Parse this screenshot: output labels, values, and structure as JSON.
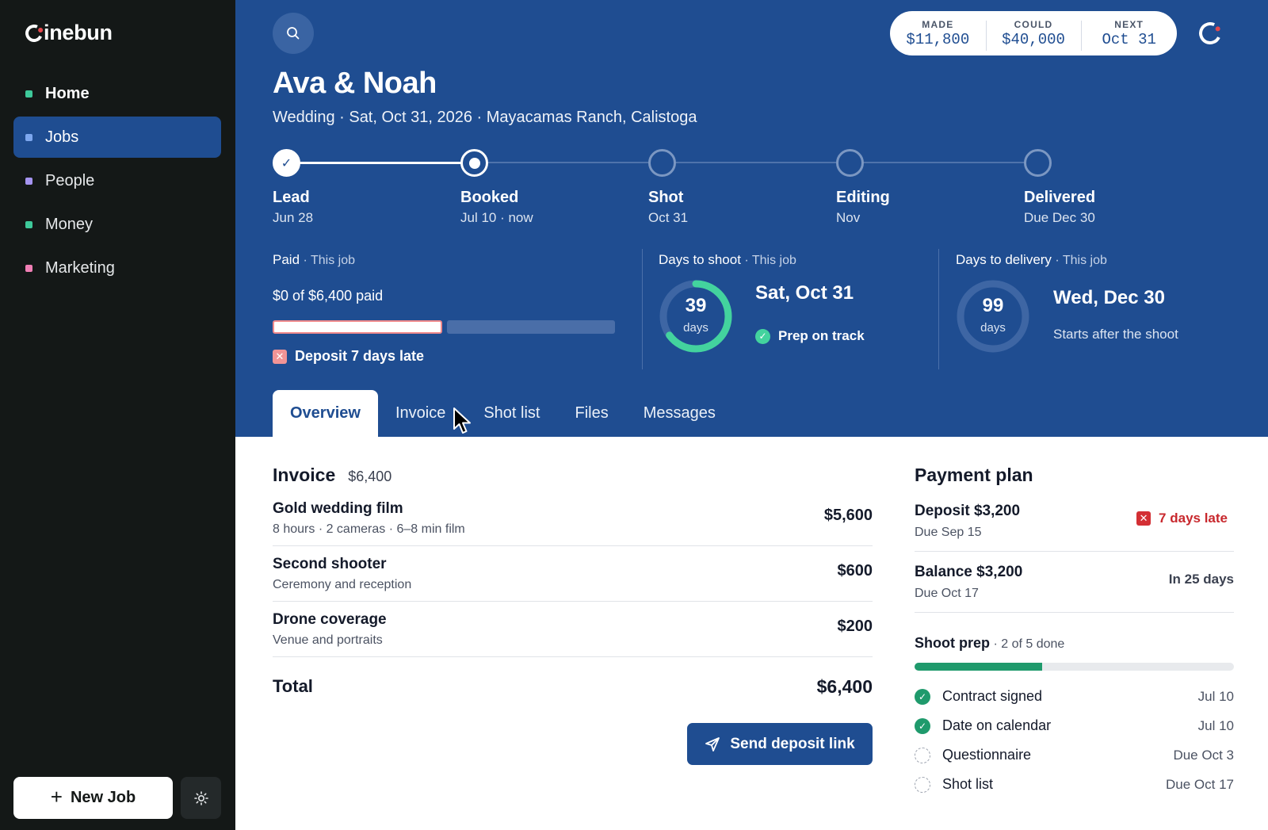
{
  "app": {
    "logo_rest": "inebun"
  },
  "sidebar": {
    "items": [
      {
        "label": "Home",
        "color": "#3ec99a"
      },
      {
        "label": "Jobs",
        "color": "#7da7ee"
      },
      {
        "label": "People",
        "color": "#a594f0"
      },
      {
        "label": "Money",
        "color": "#3ec99a"
      },
      {
        "label": "Marketing",
        "color": "#f07fb5"
      }
    ],
    "new_job_label": "New Job"
  },
  "stats": {
    "made_label": "MADE",
    "made_value": "$11,800",
    "could_label": "COULD",
    "could_value": "$40,000",
    "next_label": "NEXT",
    "next_value": "Oct 31"
  },
  "job": {
    "title": "Ava & Noah",
    "subtitle": "Wedding · Sat, Oct 31, 2026 · Mayacamas Ranch, Calistoga"
  },
  "stepper": {
    "steps": [
      {
        "label": "Lead",
        "date": "Jun 28"
      },
      {
        "label": "Booked",
        "date": "Jul 10 · now"
      },
      {
        "label": "Shot",
        "date": "Oct 31"
      },
      {
        "label": "Editing",
        "date": "Nov"
      },
      {
        "label": "Delivered",
        "date": "Due Dec 30"
      }
    ]
  },
  "metrics": {
    "paid": {
      "title": "Paid",
      "scope": " · This job",
      "amount": "$0 of $6,400 paid",
      "late_note": "Deposit 7 days late"
    },
    "shoot": {
      "title": "Days to shoot",
      "scope": " · This job",
      "days": "39",
      "unit": "days",
      "ring_fraction": 0.65,
      "date": "Sat, Oct 31",
      "status": "Prep on track"
    },
    "delivery": {
      "title": "Days to delivery",
      "scope": " · This job",
      "days": "99",
      "unit": "days",
      "date": "Wed, Dec 30",
      "note": "Starts after the shoot"
    }
  },
  "tabs": [
    "Overview",
    "Invoice",
    "Shot list",
    "Files",
    "Messages"
  ],
  "invoice": {
    "title": "Invoice",
    "amount": "$6,400",
    "items": [
      {
        "name": "Gold wedding film",
        "desc": "8 hours · 2 cameras · 6–8 min film",
        "price": "$5,600"
      },
      {
        "name": "Second shooter",
        "desc": "Ceremony and reception",
        "price": "$600"
      },
      {
        "name": "Drone coverage",
        "desc": "Venue and portraits",
        "price": "$200"
      }
    ],
    "total_label": "Total",
    "total_value": "$6,400",
    "send_label": "Send deposit link"
  },
  "plan": {
    "title": "Payment plan",
    "rows": [
      {
        "name": "Deposit $3,200",
        "due": "Due Sep 15",
        "status": "7 days late"
      },
      {
        "name": "Balance $3,200",
        "due": "Due Oct 17",
        "status": "In 25 days"
      }
    ],
    "prep_title": "Shoot prep",
    "prep_count": " · 2 of 5 done",
    "prep_fraction": 0.4,
    "checklist": [
      {
        "label": "Contract signed",
        "date": "Jul 10"
      },
      {
        "label": "Date on calendar",
        "date": "Jul 10"
      },
      {
        "label": "Questionnaire",
        "date": "Due Oct 3"
      },
      {
        "label": "Shot list",
        "date": "Due Oct 17"
      }
    ]
  }
}
